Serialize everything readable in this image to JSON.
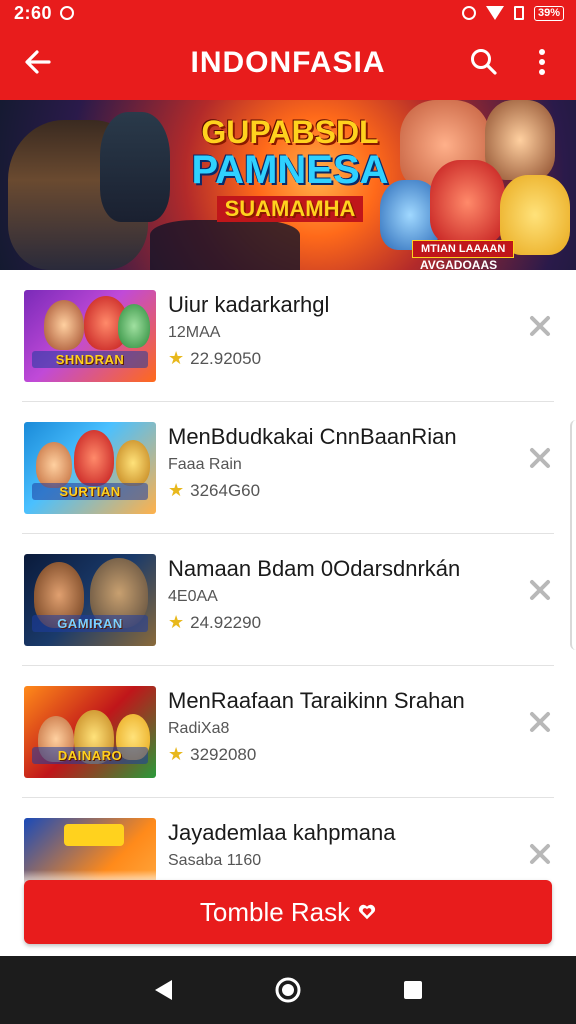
{
  "status_bar": {
    "time": "2:60",
    "battery": "39%"
  },
  "app_bar": {
    "title": "INDONFASIA",
    "back_icon": "arrow-left-icon",
    "search_icon": "search-icon",
    "more_icon": "more-vertical-icon"
  },
  "banner": {
    "line1": "GUPABSDL",
    "line2": "PAMNESA",
    "line3": "SUAMAMHA",
    "badge": "MTIAN LAAAAN",
    "badge2": "AVGADOAAS"
  },
  "items": [
    {
      "title": "Uiur kadarkarhgl",
      "subtitle": "12MAA",
      "rating": "22.92050",
      "thumb_label": "SHNDRAN",
      "action_icon": "close-icon",
      "colors": [
        "#7a2ab8",
        "#ff6a1a"
      ]
    },
    {
      "title": "MenBdudkakai CnnBaanRian",
      "subtitle": "Faaa Rain",
      "rating": "3264G60",
      "thumb_label": "SURTIAN",
      "action_icon": "close-icon",
      "colors": [
        "#1a8ad8",
        "#ffb14a"
      ]
    },
    {
      "title": "Namaan Bdam 0Odarsdnrkán",
      "subtitle": "4E0AA",
      "rating": "24.92290",
      "thumb_label": "GAMIRAN",
      "action_icon": "close-icon",
      "colors": [
        "#1a3a6a",
        "#8a6a3a"
      ]
    },
    {
      "title": "MenRaafaan Taraikinn Srahan",
      "subtitle": "RadiXa8",
      "rating": "3292080",
      "thumb_label": "DAINARO",
      "action_icon": "close-icon",
      "colors": [
        "#c0161a",
        "#2a9a3a"
      ]
    },
    {
      "title": "Jayademlaa kahpmana",
      "subtitle": "Sasaba 1160",
      "rating": "",
      "thumb_label": "",
      "action_icon": "close-icon",
      "colors": [
        "#1a4ab8",
        "#ffb14a"
      ]
    }
  ],
  "cta": {
    "label": "Tomble Rask",
    "icon": "heart-icon"
  },
  "nav": {
    "back_icon": "nav-back-icon",
    "home_icon": "nav-home-icon",
    "recents_icon": "nav-recents-icon"
  }
}
